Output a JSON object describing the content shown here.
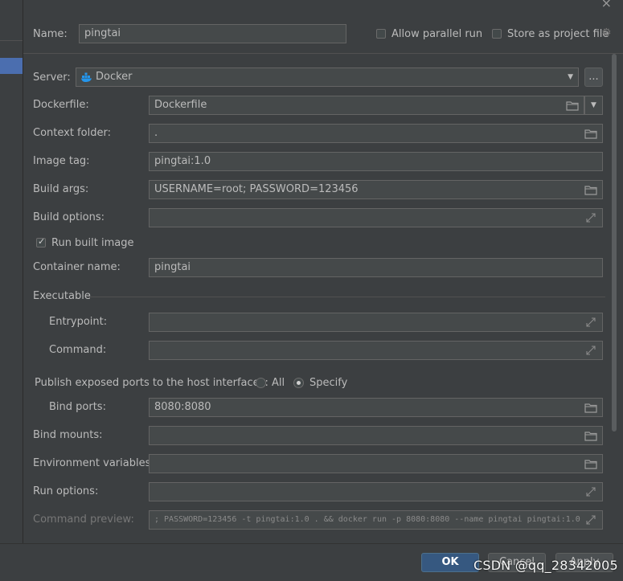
{
  "header": {
    "name_label": "Name:",
    "name_value": "pingtai",
    "allow_parallel_label": "Allow parallel run",
    "store_as_project_label": "Store as project file"
  },
  "server": {
    "label": "Server:",
    "value": "Docker",
    "more_label": "..."
  },
  "dockerfile": {
    "label": "Dockerfile:",
    "value": "Dockerfile"
  },
  "context_folder": {
    "label": "Context folder:",
    "value": "."
  },
  "image_tag": {
    "label": "Image tag:",
    "value": "pingtai:1.0"
  },
  "build_args": {
    "label": "Build args:",
    "value": "USERNAME=root; PASSWORD=123456"
  },
  "build_options": {
    "label": "Build options:",
    "value": ""
  },
  "run_built_image": {
    "label": "Run built image",
    "checked": true
  },
  "container_name": {
    "label": "Container name:",
    "value": "pingtai"
  },
  "executable": {
    "section_label": "Executable",
    "entrypoint_label": "Entrypoint:",
    "entrypoint_value": "",
    "command_label": "Command:",
    "command_value": ""
  },
  "publish": {
    "label": "Publish exposed ports to the host interfaces:",
    "option_all": "All",
    "option_specify": "Specify",
    "selected": "Specify"
  },
  "bind_ports": {
    "label": "Bind ports:",
    "value": "8080:8080"
  },
  "bind_mounts": {
    "label": "Bind mounts:",
    "value": ""
  },
  "env_vars": {
    "label": "Environment variables:",
    "value": ""
  },
  "run_options": {
    "label": "Run options:",
    "value": ""
  },
  "command_preview": {
    "label": "Command preview:",
    "value": "; PASSWORD=123456 -t pingtai:1.0 . && docker run -p 8080:8080 --name pingtai pingtai:1.0"
  },
  "footer": {
    "ok_label": "OK",
    "cancel_label": "Cancel",
    "apply_label": "Apply"
  },
  "watermark": "CSDN @qq_28342005",
  "colors": {
    "background": "#3c3f41",
    "field": "#45494a",
    "primary_button": "#365880",
    "docker_blue": "#2496ed"
  }
}
